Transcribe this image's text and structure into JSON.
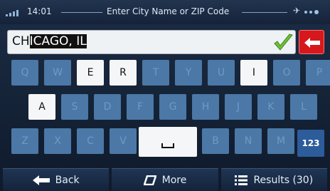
{
  "status": {
    "time": "14:01",
    "title": "Enter City Name or ZIP Code"
  },
  "input": {
    "prefix": "CH",
    "selected": "ICAGO, IL"
  },
  "keyboard": {
    "rows": [
      {
        "keys": [
          "Q",
          "W",
          "E",
          "R",
          "T",
          "Y",
          "U",
          "I",
          "O",
          "P"
        ]
      },
      {
        "keys": [
          "A",
          "S",
          "D",
          "F",
          "G",
          "H",
          "J",
          "K",
          "L"
        ]
      },
      {
        "keys": [
          "Z",
          "X",
          "C",
          "V",
          "B",
          "N",
          "M"
        ]
      }
    ],
    "enabled_keys": [
      "E",
      "R",
      "I",
      "A"
    ],
    "numeric_toggle_label": "123"
  },
  "toolbar": {
    "back_label": "Back",
    "more_label": "More",
    "results_label": "Results (30)"
  },
  "colors": {
    "accent": "#d6181d",
    "key_disabled": "#4b78a6",
    "check": "#6fbf3a"
  }
}
